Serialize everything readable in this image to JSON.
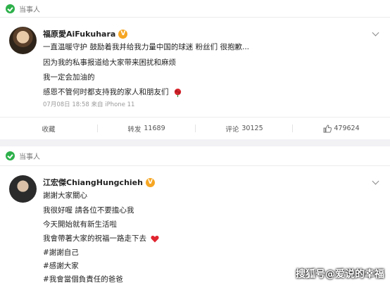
{
  "post1": {
    "tag_label": "当事人",
    "author_name": "福原愛AiFukuhara",
    "verified_icon_text": "V",
    "lines": [
      "一直温暖守护 鼓励着我并给我力量中国的球迷 粉丝们 很抱歉...",
      "因为我的私事报道给大家带来困扰和麻烦",
      "我一定会加油的",
      "感恩不管何时都支持我的家人和朋友们"
    ],
    "meta": "07月08日 18:58 来自 iPhone 11",
    "actions": {
      "favorite_label": "收藏",
      "repost_label": "转发",
      "repost_count": "11689",
      "comment_label": "评论",
      "comment_count": "30125",
      "like_count": "479624"
    }
  },
  "post2": {
    "tag_label": "当事人",
    "author_name": "江宏傑ChiangHungchieh",
    "verified_icon_text": "V",
    "lines": [
      "謝謝大家關心",
      "我很好喔 請各位不要擔心我",
      "今天開始就有新生活啦",
      "我會帶著大家的祝福一路走下去",
      "#謝謝自己",
      "#感謝大家",
      "#我會當個負責任的爸爸"
    ]
  },
  "watermark": "搜狐号@爱说的幸福",
  "colors": {
    "verified": "#f6a623",
    "tag_check": "#2db04a",
    "heart": "#e0242f",
    "rose": "#d9262e"
  }
}
